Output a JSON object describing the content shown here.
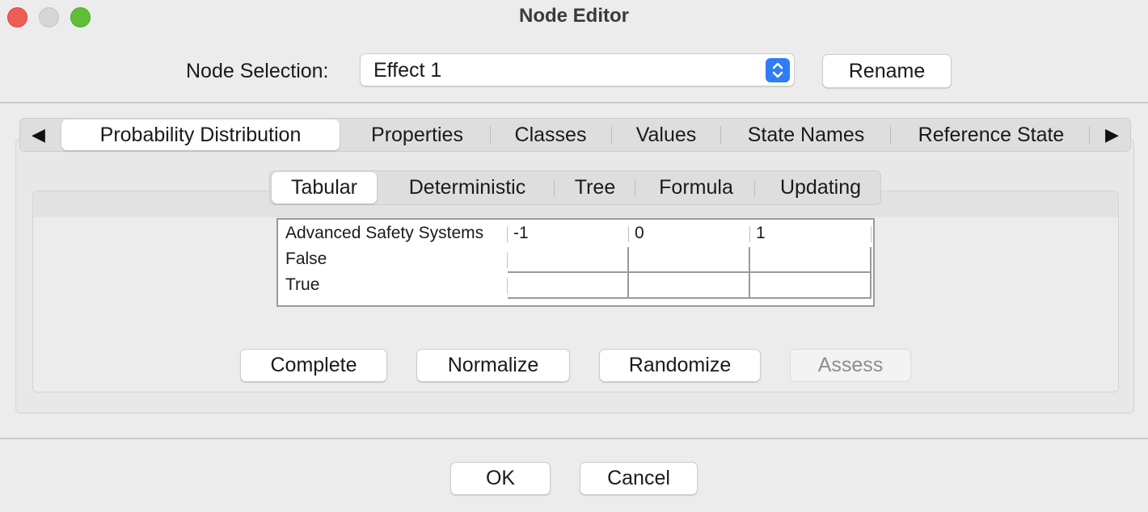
{
  "window": {
    "title": "Node Editor"
  },
  "node_selection": {
    "label": "Node Selection:",
    "value": "Effect 1",
    "rename_label": "Rename"
  },
  "tabs": [
    {
      "label": "Probability Distribution",
      "active": true
    },
    {
      "label": "Properties"
    },
    {
      "label": "Classes"
    },
    {
      "label": "Values"
    },
    {
      "label": "State Names"
    },
    {
      "label": "Reference State"
    }
  ],
  "subtabs": [
    {
      "label": "Tabular",
      "active": true
    },
    {
      "label": "Deterministic"
    },
    {
      "label": "Tree"
    },
    {
      "label": "Formula"
    },
    {
      "label": "Updating"
    }
  ],
  "table": {
    "parent_label": "Advanced Safety Systems",
    "columns": [
      "-1",
      "0",
      "1"
    ],
    "rows": [
      {
        "label": "False",
        "values": [
          "",
          "",
          ""
        ]
      },
      {
        "label": "True",
        "values": [
          "",
          "",
          ""
        ]
      }
    ]
  },
  "actions": {
    "complete": "Complete",
    "normalize": "Normalize",
    "randomize": "Randomize",
    "assess": "Assess"
  },
  "footer": {
    "ok": "OK",
    "cancel": "Cancel"
  },
  "colors": {
    "accent": "#2f7df6",
    "close": "#ee5d55",
    "maximize": "#5fc038"
  }
}
